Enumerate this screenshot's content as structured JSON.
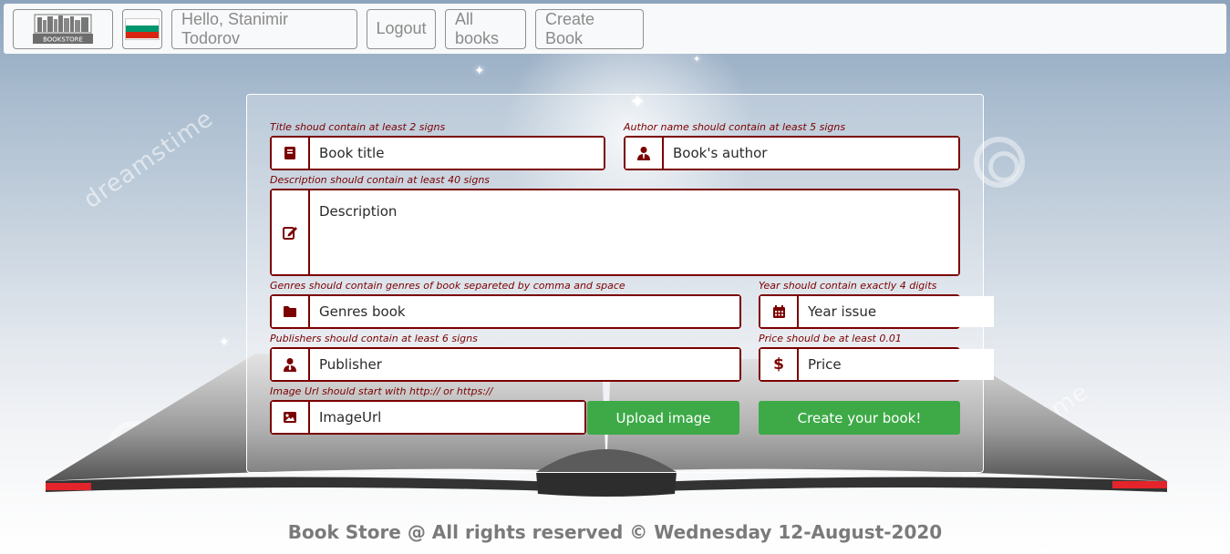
{
  "navbar": {
    "logo_text": "BOOKSTORE",
    "flag_colors": [
      "#ffffff",
      "#00966e",
      "#d62612"
    ],
    "greeting": "Hello, Stanimir Todorov",
    "logout": "Logout",
    "all_books": "All books",
    "create_book": "Create Book"
  },
  "form": {
    "title_hint": "Title shoud contain at least 2 signs",
    "title_placeholder": "Book title",
    "author_hint": "Author name should contain at least 5 signs",
    "author_placeholder": "Book's author",
    "description_hint": "Description should contain at least 40 signs",
    "description_placeholder": "Description",
    "genres_hint": "Genres should contain genres of book separeted by comma and space",
    "genres_placeholder": "Genres book",
    "year_hint": "Year should contain exactly 4 digits",
    "year_placeholder": "Year issue",
    "publisher_hint": "Publishers should contain at least 6 signs",
    "publisher_placeholder": "Publisher",
    "price_hint": "Price should be at least 0.01",
    "price_placeholder": "Price",
    "image_hint": "Image Url should start with http:// or https://",
    "image_placeholder": "ImageUrl",
    "upload_button": "Upload image",
    "submit_button": "Create your book!"
  },
  "icons": {
    "title": "book-icon",
    "author": "user-icon",
    "description": "edit-icon",
    "genres": "folder-icon",
    "year": "calendar-icon",
    "publisher": "user-tie-icon",
    "price": "dollar-icon",
    "image": "image-icon"
  },
  "background": {
    "watermark": "dreamstime"
  },
  "colors": {
    "accent": "#7b0000",
    "button_green": "#3daa47"
  },
  "footer": {
    "text": "Book Store @ All rights reserved © Wednesday 12-August-2020"
  }
}
